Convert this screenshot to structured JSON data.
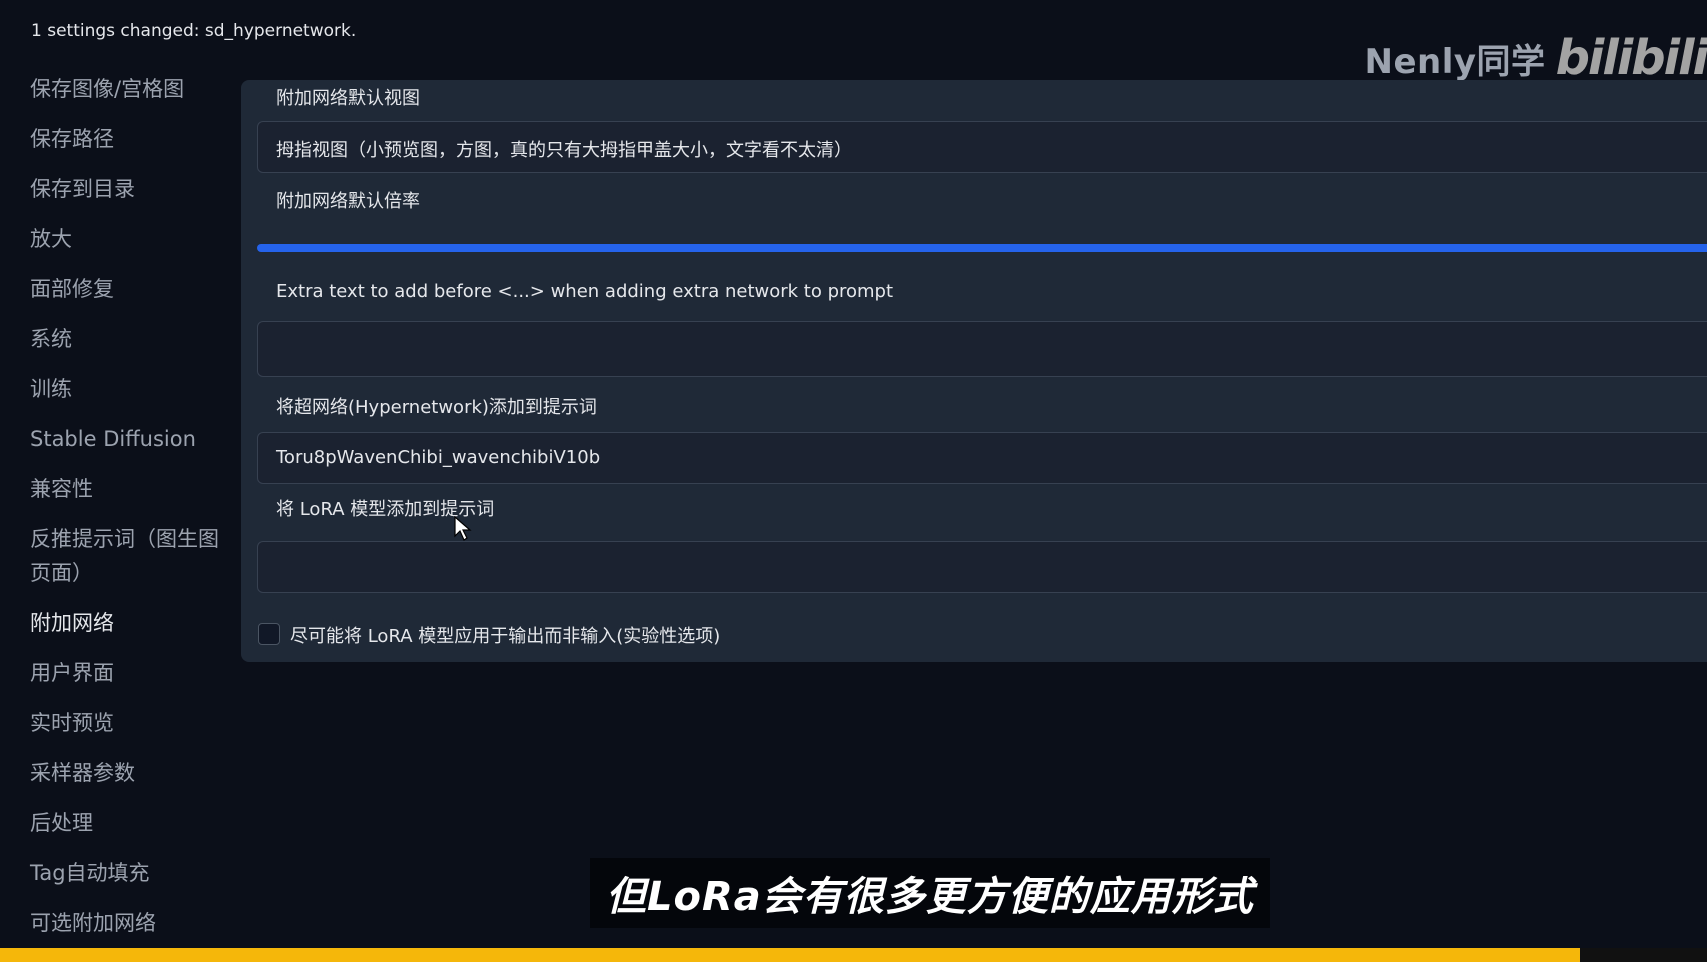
{
  "status_message": "1 settings changed: sd_hypernetwork.",
  "watermark": {
    "text": "Nenly同学",
    "logo": "bilibili"
  },
  "sidebar": {
    "items": [
      {
        "label": "保存图像/宫格图",
        "active": false
      },
      {
        "label": "保存路径",
        "active": false
      },
      {
        "label": "保存到目录",
        "active": false
      },
      {
        "label": "放大",
        "active": false
      },
      {
        "label": "面部修复",
        "active": false
      },
      {
        "label": "系统",
        "active": false
      },
      {
        "label": "训练",
        "active": false
      },
      {
        "label": "Stable Diffusion",
        "active": false
      },
      {
        "label": "兼容性",
        "active": false
      },
      {
        "label": "反推提示词（图生图页面）",
        "active": false
      },
      {
        "label": "附加网络",
        "active": true
      },
      {
        "label": "用户界面",
        "active": false
      },
      {
        "label": "实时预览",
        "active": false
      },
      {
        "label": "采样器参数",
        "active": false
      },
      {
        "label": "后处理",
        "active": false
      },
      {
        "label": "Tag自动填充",
        "active": false
      },
      {
        "label": "可选附加网络",
        "active": false
      }
    ]
  },
  "settings": {
    "default_view_label": "附加网络默认视图",
    "default_view_value": "拇指视图（小预览图，方图，真的只有大拇指甲盖大小，文字看不太清）",
    "default_multiplier_label": "附加网络默认倍率",
    "default_multiplier_fill": 1.0,
    "extra_text_label": "Extra text to add before <...> when adding extra network to prompt",
    "extra_text_value": "",
    "hypernetwork_label": "将超网络(Hypernetwork)添加到提示词",
    "hypernetwork_value": "Toru8pWavenChibi_wavenchibiV10b",
    "lora_label": "将 LoRA 模型添加到提示词",
    "lora_value": "",
    "lora_output_checkbox_label": "尽可能将 LoRA 模型应用于输出而非输入(实验性选项)",
    "lora_output_checked": false
  },
  "subtitle": "但LoRa会有很多更方便的应用形式",
  "colors": {
    "accent": "#2563eb",
    "background": "#0b0f19",
    "panel": "#1f2937",
    "bottom_bar": "#f5b70a"
  }
}
